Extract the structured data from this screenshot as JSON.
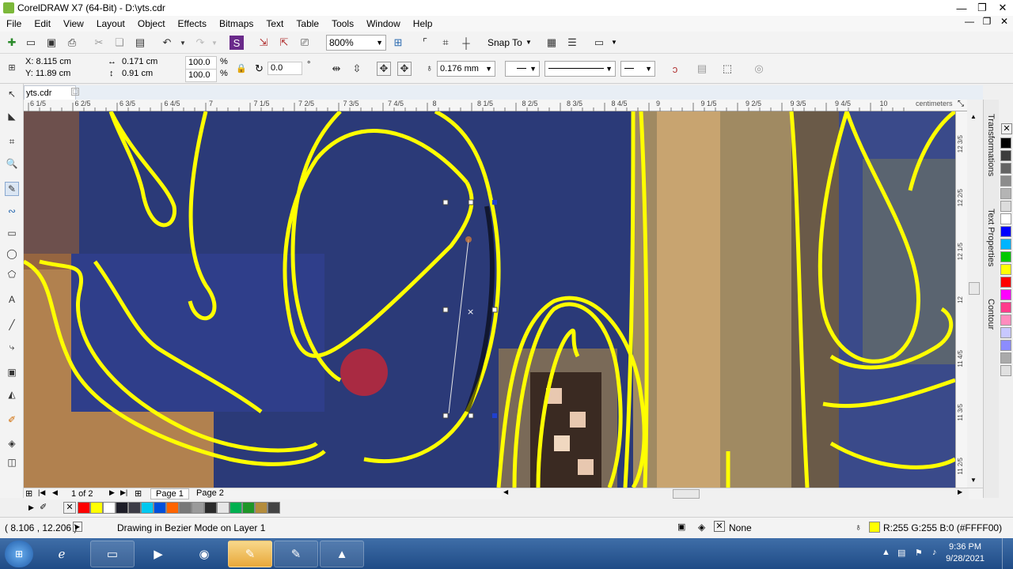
{
  "window": {
    "title": "CorelDRAW X7 (64-Bit) - D:\\yts.cdr",
    "min": "—",
    "restore": "❐",
    "close": "✕"
  },
  "menu": [
    "File",
    "Edit",
    "View",
    "Layout",
    "Object",
    "Effects",
    "Bitmaps",
    "Text",
    "Table",
    "Tools",
    "Window",
    "Help"
  ],
  "toolbar": {
    "zoom": "800%",
    "snap": "Snap To"
  },
  "properties": {
    "x": "X: 8.115 cm",
    "y": "Y: 11.89 cm",
    "width": "0.171 cm",
    "height": "0.91 cm",
    "scale_w": "100.0",
    "scale_h": "100.0",
    "percent": "%",
    "rotation": "0.0",
    "degree": "°",
    "outline_width": "0.176 mm"
  },
  "document": {
    "tab": "yts.cdr"
  },
  "ruler": {
    "labels": [
      "6 1/5",
      "6 2/5",
      "6 3/5",
      "6 4/5",
      "7",
      "7 1/5",
      "7 2/5",
      "7 3/5",
      "7 4/5",
      "8",
      "8 1/5",
      "8 2/5",
      "8 3/5",
      "8 4/5",
      "9",
      "9 1/5",
      "9 2/5",
      "9 3/5",
      "9 4/5",
      "10"
    ],
    "unit": "centimeters",
    "v_labels": [
      "12 3/5",
      "12 2/5",
      "12 1/5",
      "12",
      "11 4/5",
      "11 3/5",
      "11 2/5"
    ]
  },
  "dockers": [
    "Transformations",
    "Text Properties",
    "Contour"
  ],
  "pages": {
    "counter": "1 of 2",
    "tabs": [
      "Page 1",
      "Page 2"
    ]
  },
  "palette_h": [
    "#ff0000",
    "#ffff00",
    "#ffffff",
    "#1e1e28",
    "#3c3c46",
    "#00c8f0",
    "#0050dc",
    "#ff6400",
    "#787878",
    "#9a9a9a",
    "#2a2a2a",
    "#e6e6e6",
    "#00b050",
    "#1e9628",
    "#b48c3c",
    "#444444"
  ],
  "palette_v": [
    "#000000",
    "#3c3c3c",
    "#646464",
    "#8c8c8c",
    "#b4b4b4",
    "#dcdcdc",
    "#ffffff",
    "#0000ff",
    "#00b4ff",
    "#00c800",
    "#ffff00",
    "#ff0000",
    "#ff00ff",
    "#ff3c8c",
    "#ff8cbe",
    "#c8c8ff",
    "#8c8cff",
    "#aaaaaa",
    "#e0e0e0"
  ],
  "status": {
    "coords": "( 8.106 , 12.206 )",
    "mode": "Drawing in Bezier Mode on Layer 1",
    "fill": "None",
    "outline_color": "R:255 G:255 B:0 (#FFFF00)",
    "outline_swatch": "#ffff00"
  },
  "taskbar": {
    "time": "9:36 PM",
    "date": "9/28/2021"
  }
}
